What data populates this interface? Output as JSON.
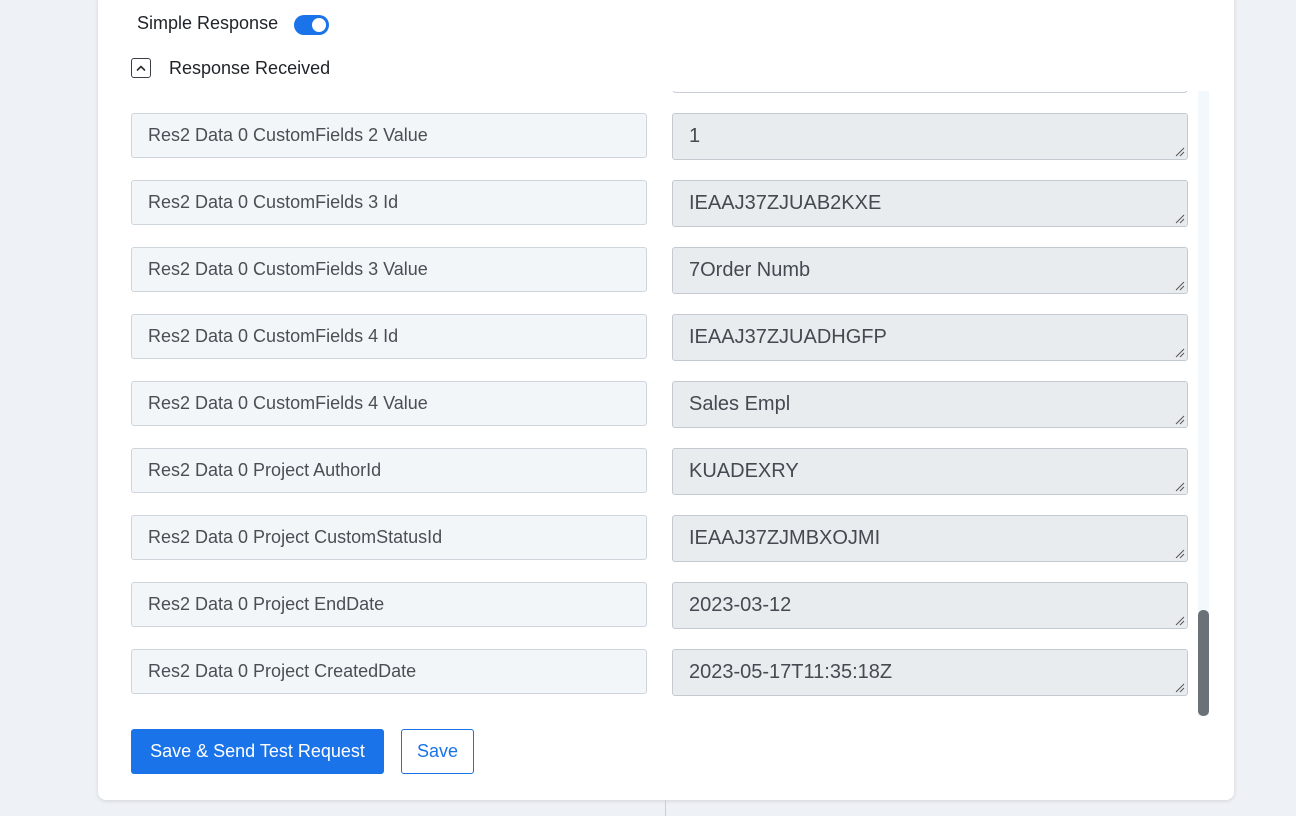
{
  "settings": {
    "simple_response_label": "Simple Response",
    "simple_response_enabled": true,
    "response_received_label": "Response Received",
    "response_received_expanded": true
  },
  "fields": [
    {
      "key": "Res2 Data 0 CustomFields 2 Value",
      "value": "1"
    },
    {
      "key": "Res2 Data 0 CustomFields 3 Id",
      "value": "IEAAJ37ZJUAB2KXE"
    },
    {
      "key": "Res2 Data 0 CustomFields 3 Value",
      "value": "7Order Numb"
    },
    {
      "key": "Res2 Data 0 CustomFields 4 Id",
      "value": "IEAAJ37ZJUADHGFP"
    },
    {
      "key": "Res2 Data 0 CustomFields 4 Value",
      "value": "Sales Empl"
    },
    {
      "key": "Res2 Data 0 Project AuthorId",
      "value": "KUADEXRY"
    },
    {
      "key": "Res2 Data 0 Project CustomStatusId",
      "value": "IEAAJ37ZJMBXOJMI"
    },
    {
      "key": "Res2 Data 0 Project EndDate",
      "value": "2023-03-12"
    },
    {
      "key": "Res2 Data 0 Project CreatedDate",
      "value": "2023-05-17T11:35:18Z"
    }
  ],
  "actions": {
    "save_and_send_label": "Save & Send Test Request",
    "save_label": "Save"
  },
  "colors": {
    "accent": "#1a73e8",
    "key_bg": "#f3f6f9",
    "value_bg": "#e9ecef",
    "page_bg": "#eef1f5"
  },
  "icons": {
    "collapse": "chevron-up-icon",
    "resize": "resize-grip-icon"
  }
}
